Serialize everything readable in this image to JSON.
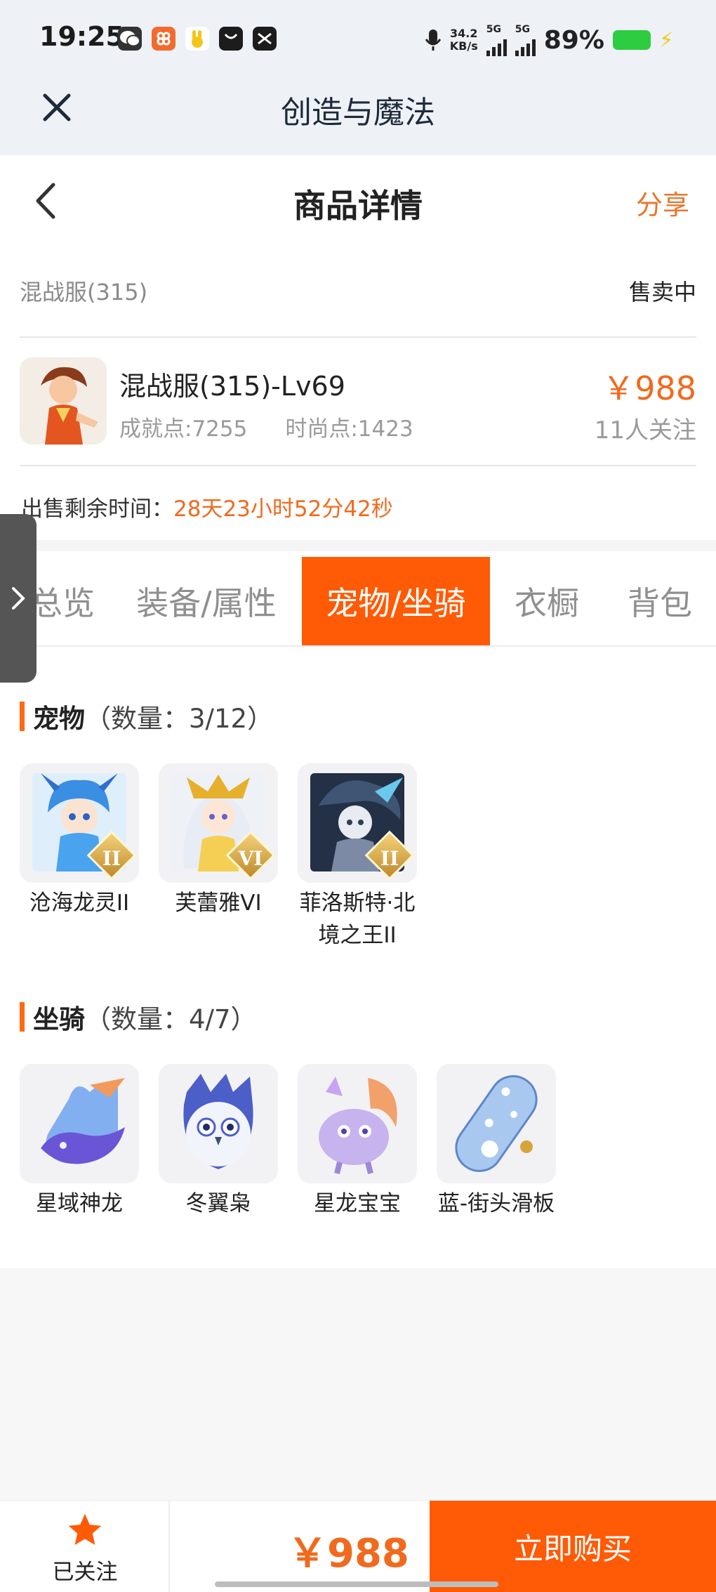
{
  "status_bar": {
    "time": "19:25",
    "speed_value": "34.2",
    "speed_unit": "KB/s",
    "network1": "5G",
    "network2": "5G",
    "battery": "89%",
    "battery_color": "#2ecc40"
  },
  "app_header": {
    "title": "创造与魔法",
    "close_icon": "close-icon"
  },
  "page_header": {
    "title": "商品详情",
    "share_label": "分享",
    "accent": "#e8762a"
  },
  "listing": {
    "server": "混战服(315)",
    "status": "售卖中",
    "character_name": "混战服(315)-Lv69",
    "achievement": "成就点:7255",
    "fashion": "时尚点:1423",
    "price": "￥988",
    "followers": "11人关注",
    "time_label": "出售剩余时间：",
    "time_value": "28天23小时52分42秒"
  },
  "tabs": [
    {
      "label": "总览",
      "active": false
    },
    {
      "label": "装备/属性",
      "active": false
    },
    {
      "label": "宠物/坐骑",
      "active": true
    },
    {
      "label": "衣橱",
      "active": false
    },
    {
      "label": "背包",
      "active": false
    }
  ],
  "pets": {
    "title": "宠物",
    "count": "（数量：3/12）",
    "items": [
      {
        "name": "沧海龙灵II",
        "rank": "II"
      },
      {
        "name": "芙蕾雅VI",
        "rank": "VI"
      },
      {
        "name": "菲洛斯特·北境之王II",
        "rank": "II"
      }
    ]
  },
  "mounts": {
    "title": "坐骑",
    "count": "（数量：4/7）",
    "items": [
      {
        "name": "星域神龙"
      },
      {
        "name": "冬翼枭"
      },
      {
        "name": "星龙宝宝"
      },
      {
        "name": "蓝-街头滑板"
      }
    ]
  },
  "bottom_bar": {
    "follow_label": "已关注",
    "price": "￥988",
    "buy_label": "立即购买",
    "primary_color": "#ff5a05"
  }
}
